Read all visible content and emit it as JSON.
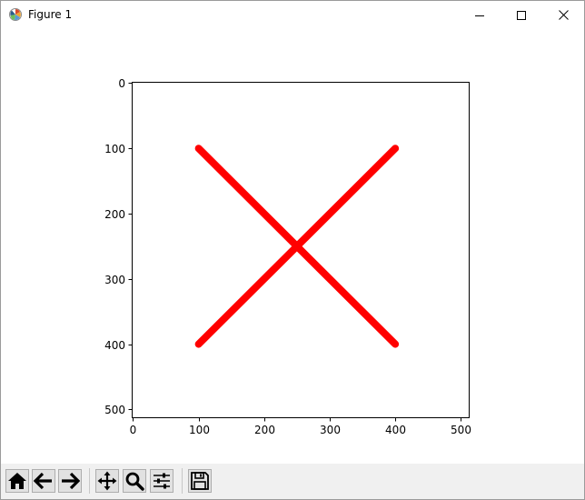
{
  "window": {
    "title": "Figure 1",
    "icons": {
      "app": "matplotlib-icon",
      "minimize": "minimize-icon",
      "maximize": "maximize-icon",
      "close": "close-icon"
    }
  },
  "toolbar": {
    "buttons": [
      {
        "name": "home-button",
        "icon": "home-icon"
      },
      {
        "name": "back-button",
        "icon": "back-arrow-icon"
      },
      {
        "name": "forward-button",
        "icon": "forward-arrow-icon"
      },
      {
        "name": "pan-button",
        "icon": "move-icon"
      },
      {
        "name": "zoom-button",
        "icon": "magnifier-icon"
      },
      {
        "name": "configure-subplots-button",
        "icon": "sliders-icon"
      },
      {
        "name": "save-button",
        "icon": "floppy-disk-icon"
      }
    ]
  },
  "chart_data": {
    "type": "line",
    "title": "",
    "xlabel": "",
    "ylabel": "",
    "xlim": [
      -2,
      512
    ],
    "ylim": [
      512,
      -2
    ],
    "y_inverted": true,
    "xticks": [
      0,
      100,
      200,
      300,
      400,
      500
    ],
    "xtick_labels": [
      "0",
      "100",
      "200",
      "300",
      "400",
      "500"
    ],
    "yticks": [
      0,
      100,
      200,
      300,
      400,
      500
    ],
    "ytick_labels": [
      "0",
      "100",
      "200",
      "300",
      "400",
      "500"
    ],
    "grid": false,
    "series": [
      {
        "x": [
          100,
          400
        ],
        "y": [
          100,
          400
        ],
        "color": "#ff0000"
      },
      {
        "x": [
          100,
          400
        ],
        "y": [
          400,
          100
        ],
        "color": "#ff0000"
      }
    ]
  }
}
